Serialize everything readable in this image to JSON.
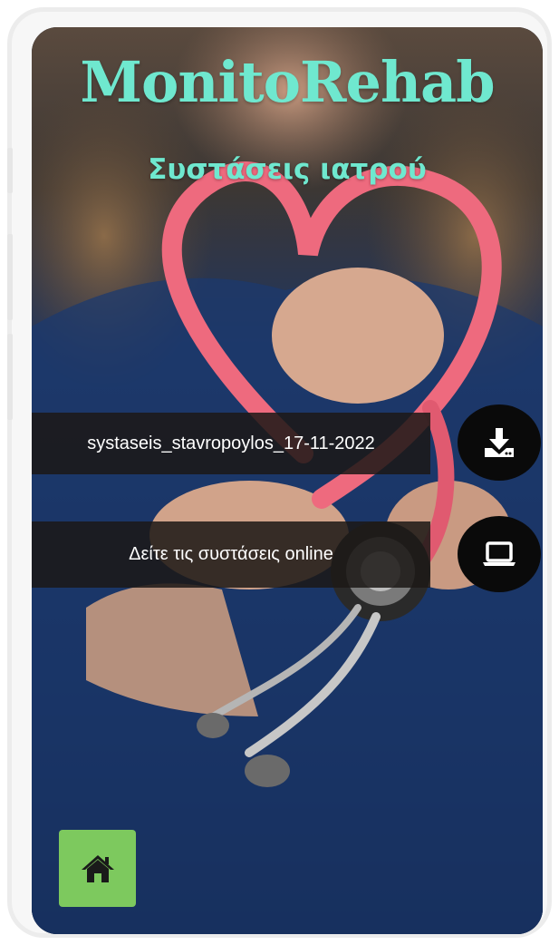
{
  "app": {
    "title": "MonitoRehab",
    "subtitle": "Συστάσεις ιατρού"
  },
  "actions": {
    "download_label": "systaseis_stavropoylos_17-11-2022",
    "download_icon": "download-icon",
    "online_label": "Δείτε τις συστάσεις online",
    "online_icon": "laptop-icon"
  },
  "nav": {
    "home_icon": "home-icon"
  },
  "colors": {
    "title": "#6fe8cf",
    "home_button": "#7dc95e",
    "bar": "#1c1816",
    "round_button": "#0a0a0a"
  }
}
